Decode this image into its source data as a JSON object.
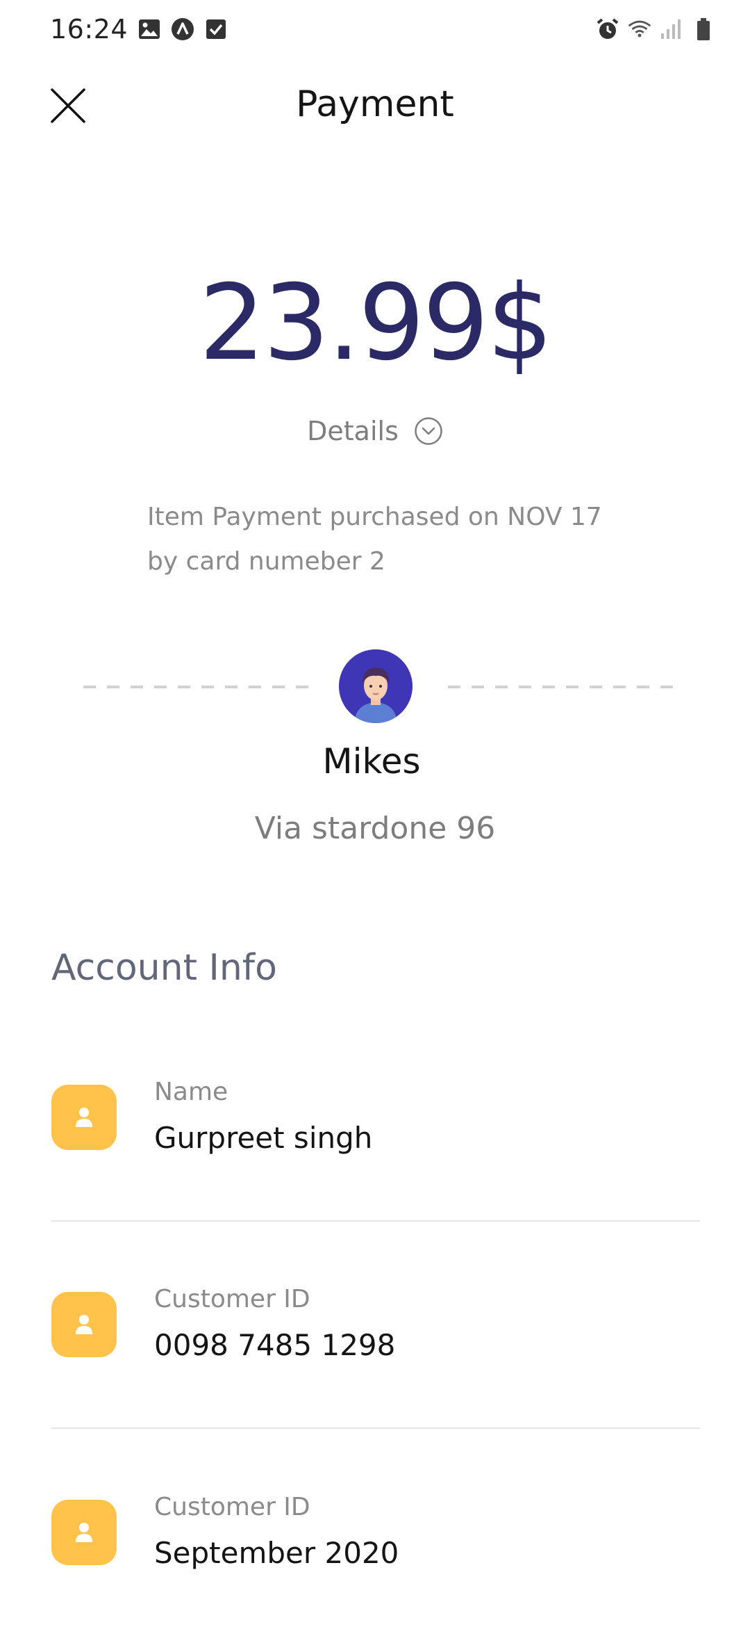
{
  "status_bar": {
    "time": "16:24",
    "left_icons": [
      "image-icon",
      "app-icon",
      "checkbox-icon"
    ],
    "right_icons": [
      "alarm-icon",
      "wifi-icon",
      "signal-icon",
      "battery-icon"
    ]
  },
  "header": {
    "title": "Payment",
    "close_icon": "close-icon"
  },
  "payment": {
    "amount": "23.99$",
    "details_label": "Details",
    "description": "Item Payment purchased on NOV 17 by card numeber 2"
  },
  "recipient": {
    "name": "Mikes",
    "address": "Via stardone 96"
  },
  "account_info": {
    "title": "Account Info",
    "rows": [
      {
        "label": "Name",
        "value": "Gurpreet singh",
        "icon": "user-icon"
      },
      {
        "label": "Customer ID",
        "value": "0098 7485 1298",
        "icon": "user-icon"
      },
      {
        "label": "Customer ID",
        "value": "September 2020",
        "icon": "user-icon"
      }
    ]
  },
  "colors": {
    "amount": "#2b2a66",
    "accent_icon_bg": "#ffc24b",
    "avatar_bg": "#3f36b5",
    "muted_text": "#8a8a8a"
  }
}
